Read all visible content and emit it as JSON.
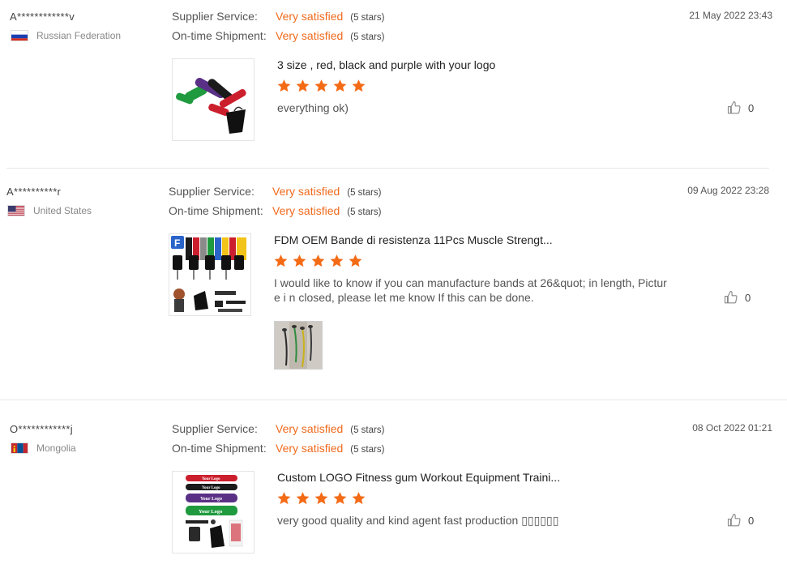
{
  "reviews": [
    {
      "name": "A************v",
      "country": "Russian Federation",
      "flag_icon": "russia-flag-icon",
      "supplier_label": "Supplier Service:",
      "supplier_value": "Very satisfied",
      "supplier_stars": "(5 stars)",
      "shipment_label": "On-time Shipment:",
      "shipment_value": "Very satisfied",
      "shipment_stars": "(5 stars)",
      "date": "21 May 2022 23:43",
      "product_title": "3 size , red, black and purple with your logo",
      "rating": 5,
      "comment": "everything ok)",
      "likes": "0"
    },
    {
      "name": "A**********r",
      "country": "United States",
      "flag_icon": "usa-flag-icon",
      "supplier_label": "Supplier Service:",
      "supplier_value": "Very satisfied",
      "supplier_stars": "(5 stars)",
      "shipment_label": "On-time Shipment:",
      "shipment_value": "Very satisfied",
      "shipment_stars": "(5 stars)",
      "date": "09 Aug 2022 23:28",
      "product_title": "FDM OEM Bande di resistenza 11Pcs Muscle Strengt...",
      "rating": 5,
      "comment": "I would like to know if you can manufacture bands at 26&quot; in length, Picture i n closed, please let me know If this can be done.",
      "likes": "0"
    },
    {
      "name": "O************j",
      "country": "Mongolia",
      "flag_icon": "mongolia-flag-icon",
      "supplier_label": "Supplier Service:",
      "supplier_value": "Very satisfied",
      "supplier_stars": "(5 stars)",
      "shipment_label": "On-time Shipment:",
      "shipment_value": "Very satisfied",
      "shipment_stars": "(5 stars)",
      "date": "08 Oct 2022 01:21",
      "product_title": "Custom LOGO Fitness gum Workout Equipment Traini...",
      "rating": 5,
      "comment": "very good quality and kind agent fast production ▯▯▯▯▯▯",
      "likes": "0",
      "thumb_labels": [
        "Your Logo",
        "Your Logo",
        "Your Logo",
        "Your Logo"
      ]
    }
  ],
  "colors": {
    "accent_orange": "#f06a1d",
    "star_orange": "#f46b16"
  }
}
